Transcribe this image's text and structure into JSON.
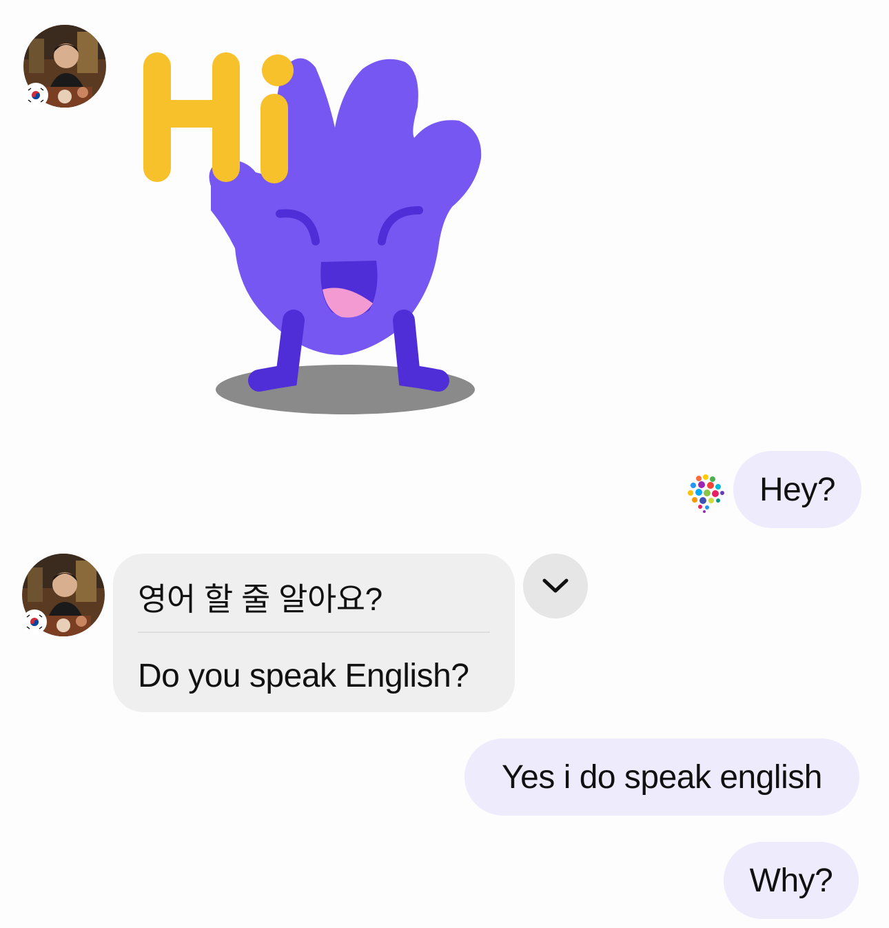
{
  "messages": [
    {
      "type": "sticker",
      "direction": "incoming",
      "text": "Hi",
      "sticker_icon": "waving-hand-sticker-icon"
    },
    {
      "type": "text",
      "direction": "outgoing",
      "text": "Hey?"
    },
    {
      "type": "translated",
      "direction": "incoming",
      "original": "영어 할 줄 알아요?",
      "translation": "Do you speak English?"
    },
    {
      "type": "text",
      "direction": "outgoing",
      "text": "Yes i do speak english"
    },
    {
      "type": "text",
      "direction": "outgoing",
      "text": "Why?"
    }
  ],
  "contact": {
    "avatar_icon": "user-avatar-icon",
    "flag_icon": "south-korea-flag-icon"
  },
  "icons": {
    "expand": "chevron-down-icon",
    "app_badge": "hellotalk-logo-icon"
  },
  "colors": {
    "outgoing_bubble": "#eeebfc",
    "incoming_bubble": "#efefef",
    "sticker_purple": "#7657f2",
    "sticker_yellow": "#f7c12c"
  }
}
